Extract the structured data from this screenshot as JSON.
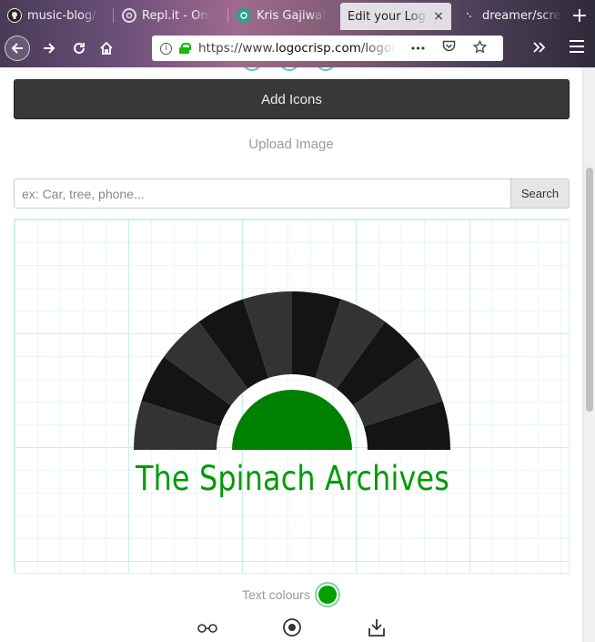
{
  "browser": {
    "tabs": [
      {
        "label": "music-blog/i",
        "icon": "github-icon",
        "active": false
      },
      {
        "label": "Repl.it - Onl",
        "icon": "replit-icon",
        "active": false
      },
      {
        "label": "Kris Gajiwal",
        "icon": "site-icon",
        "active": false
      },
      {
        "label": "Edit your Log",
        "icon": "",
        "active": true
      },
      {
        "label": "dreamer/scre",
        "icon": "site-icon",
        "active": false
      }
    ],
    "close_glyph": "×",
    "new_tab_glyph": "+",
    "url_prefix": "https://www.",
    "url_domain": "logocrisp.com",
    "url_suffix": "/logom",
    "url_dots": "•••"
  },
  "toolbar": {
    "add_icons_label": "Add Icons",
    "upload_label": "Upload Image"
  },
  "search": {
    "placeholder": "ex: Car, tree, phone...",
    "value": "",
    "button_label": "Search"
  },
  "logo": {
    "text": "The Spinach Archives",
    "text_color": "#009b00",
    "icon_colors": {
      "dark": "#141414",
      "light": "#333333",
      "center": "#008000"
    }
  },
  "text_colours": {
    "label": "Text colours",
    "swatch_color": "#00a000"
  },
  "bottom_icons": [
    "glasses-icon",
    "target-icon",
    "download-icon"
  ]
}
